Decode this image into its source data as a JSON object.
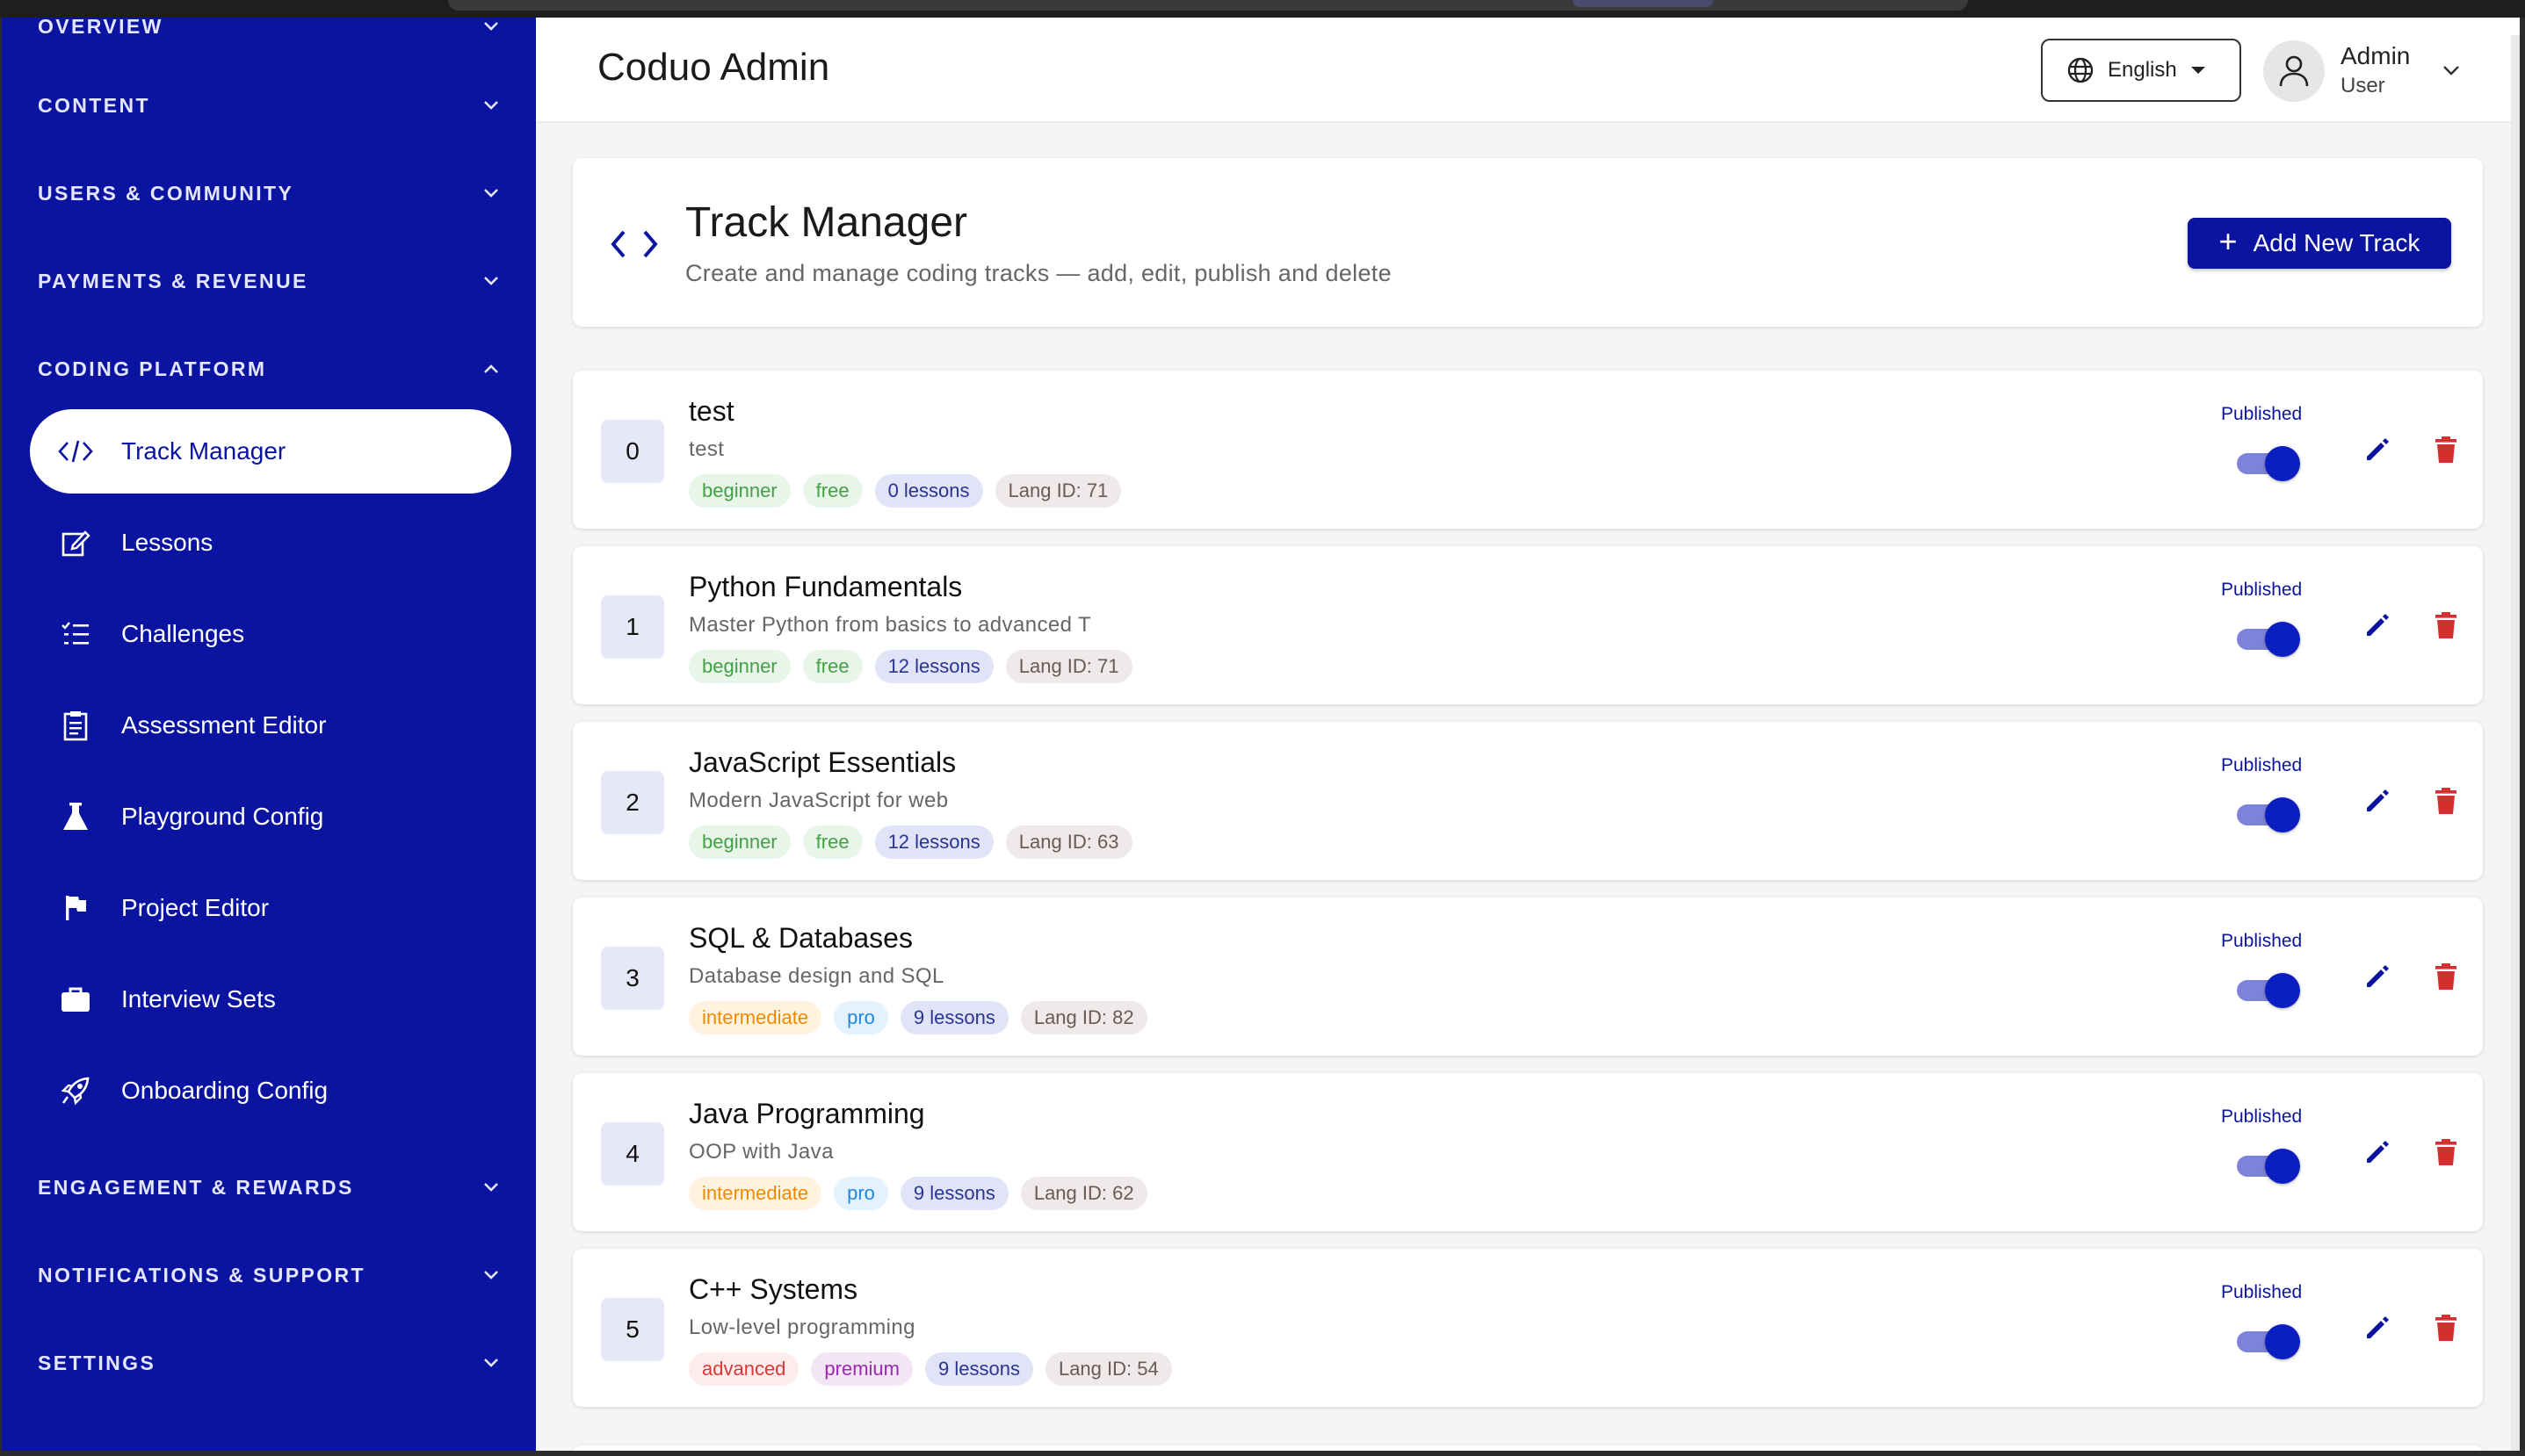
{
  "header": {
    "app_title": "Coduo Admin",
    "language": "English",
    "user_name": "Admin",
    "user_role": "User"
  },
  "sidebar": {
    "sections": [
      {
        "label": "OVERVIEW",
        "expanded": false
      },
      {
        "label": "CONTENT",
        "expanded": false
      },
      {
        "label": "USERS & COMMUNITY",
        "expanded": false
      },
      {
        "label": "PAYMENTS & REVENUE",
        "expanded": false
      },
      {
        "label": "CODING PLATFORM",
        "expanded": true
      },
      {
        "label": "ENGAGEMENT & REWARDS",
        "expanded": false
      },
      {
        "label": "NOTIFICATIONS & SUPPORT",
        "expanded": false
      },
      {
        "label": "SETTINGS",
        "expanded": false
      }
    ],
    "coding_items": [
      {
        "label": "Track Manager",
        "icon": "code-icon",
        "active": true
      },
      {
        "label": "Lessons",
        "icon": "edit-note-icon",
        "active": false
      },
      {
        "label": "Challenges",
        "icon": "checklist-icon",
        "active": false
      },
      {
        "label": "Assessment Editor",
        "icon": "clipboard-icon",
        "active": false
      },
      {
        "label": "Playground Config",
        "icon": "flask-icon",
        "active": false
      },
      {
        "label": "Project Editor",
        "icon": "flag-icon",
        "active": false
      },
      {
        "label": "Interview Sets",
        "icon": "briefcase-icon",
        "active": false
      },
      {
        "label": "Onboarding Config",
        "icon": "rocket-icon",
        "active": false
      }
    ]
  },
  "page": {
    "title": "Track Manager",
    "subtitle": "Create and manage coding tracks — add, edit, publish and delete",
    "add_button": "Add New Track"
  },
  "tracks": [
    {
      "order": "0",
      "title": "test",
      "description": "test",
      "level": "beginner",
      "plan": "free",
      "lessons": "0 lessons",
      "lang": "Lang ID: 71",
      "status": "Published",
      "published": true
    },
    {
      "order": "1",
      "title": "Python Fundamentals",
      "description": "Master Python from basics to advanced T",
      "level": "beginner",
      "plan": "free",
      "lessons": "12 lessons",
      "lang": "Lang ID: 71",
      "status": "Published",
      "published": true
    },
    {
      "order": "2",
      "title": "JavaScript Essentials",
      "description": "Modern JavaScript for web",
      "level": "beginner",
      "plan": "free",
      "lessons": "12 lessons",
      "lang": "Lang ID: 63",
      "status": "Published",
      "published": true
    },
    {
      "order": "3",
      "title": "SQL & Databases",
      "description": "Database design and SQL",
      "level": "intermediate",
      "plan": "pro",
      "lessons": "9 lessons",
      "lang": "Lang ID: 82",
      "status": "Published",
      "published": true
    },
    {
      "order": "4",
      "title": "Java Programming",
      "description": "OOP with Java",
      "level": "intermediate",
      "plan": "pro",
      "lessons": "9 lessons",
      "lang": "Lang ID: 62",
      "status": "Published",
      "published": true
    },
    {
      "order": "5",
      "title": "C++ Systems",
      "description": "Low-level programming",
      "level": "advanced",
      "plan": "premium",
      "lessons": "9 lessons",
      "lang": "Lang ID: 54",
      "status": "Published",
      "published": true
    }
  ],
  "colors": {
    "sidebar_bg": "#0a14a0",
    "accent": "#0a14a0",
    "delete": "#d32f2f"
  }
}
